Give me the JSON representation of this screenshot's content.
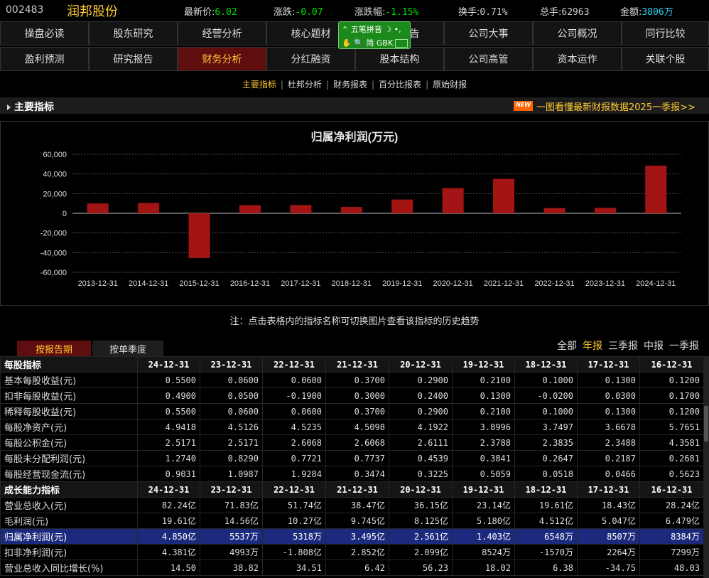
{
  "stock": {
    "code": "002483",
    "name": "润邦股份"
  },
  "quote": [
    {
      "label": "最新价:",
      "value": "6.02",
      "color": "green"
    },
    {
      "label": "涨跌:",
      "value": "-0.07",
      "color": "green"
    },
    {
      "label": "涨跌幅:",
      "value": "-1.15%",
      "color": "green"
    },
    {
      "label": "换手:",
      "value": "0.71%",
      "color": "plain"
    },
    {
      "label": "总手:",
      "value": "62963",
      "color": "plain"
    },
    {
      "label": "金额:",
      "value": "3806万",
      "color": "cyan"
    }
  ],
  "nav_row1": [
    "操盘必读",
    "股东研究",
    "经营分析",
    "核心题材",
    "新闻公告",
    "公司大事",
    "公司概况",
    "同行比较"
  ],
  "nav_row2": [
    "盈利预测",
    "研究报告",
    "财务分析",
    "分红融资",
    "股本结构",
    "公司高管",
    "资本运作",
    "关联个股"
  ],
  "active_nav": "财务分析",
  "ime": {
    "name": "五笔拼音",
    "mode": "简",
    "encoding": "GBK"
  },
  "subnav": [
    "主要指标",
    "杜邦分析",
    "财务报表",
    "百分比报表",
    "原始财报"
  ],
  "active_subnav": "主要指标",
  "section_title": "主要指标",
  "promo": {
    "badge": "NEW",
    "text": "一图看懂最新财报数据2025一季报>>"
  },
  "chart_data": {
    "type": "bar",
    "title": "归属净利润(万元)",
    "categories": [
      "2013-12-31",
      "2014-12-31",
      "2015-12-31",
      "2016-12-31",
      "2017-12-31",
      "2018-12-31",
      "2019-12-31",
      "2020-12-31",
      "2021-12-31",
      "2022-12-31",
      "2023-12-31",
      "2024-12-31"
    ],
    "values": [
      10000,
      10500,
      -45500,
      8200,
      8400,
      6500,
      14000,
      25600,
      35000,
      5318,
      5537,
      48500
    ],
    "ylim": [
      -60000,
      60000
    ],
    "yticks": [
      "60,000",
      "40,000",
      "20,000",
      "0",
      "-20,000",
      "-40,000",
      "-60,000"
    ],
    "ytick_values": [
      60000,
      40000,
      20000,
      0,
      -20000,
      -40000,
      -60000
    ],
    "bar_color": "#a31515",
    "grid": true
  },
  "note": "注：点击表格内的指标名称可切换图片查看该指标的历史趋势",
  "tabs": [
    "按报告期",
    "按单季度"
  ],
  "periods": [
    "全部",
    "年报",
    "三季报",
    "中报",
    "一季报"
  ],
  "active_period": "年报",
  "table": {
    "dates": [
      "24-12-31",
      "23-12-31",
      "22-12-31",
      "21-12-31",
      "20-12-31",
      "19-12-31",
      "18-12-31",
      "17-12-31",
      "16-12-31"
    ],
    "sections": [
      {
        "title": "每股指标",
        "rows": [
          {
            "name": "基本每股收益(元)",
            "values": [
              "0.5500",
              "0.0600",
              "0.0600",
              "0.3700",
              "0.2900",
              "0.2100",
              "0.1000",
              "0.1300",
              "0.1200"
            ]
          },
          {
            "name": "扣非每股收益(元)",
            "values": [
              "0.4900",
              "0.0500",
              "-0.1900",
              "0.3000",
              "0.2400",
              "0.1300",
              "-0.0200",
              "0.0300",
              "0.1700"
            ]
          },
          {
            "name": "稀释每股收益(元)",
            "values": [
              "0.5500",
              "0.0600",
              "0.0600",
              "0.3700",
              "0.2900",
              "0.2100",
              "0.1000",
              "0.1300",
              "0.1200"
            ]
          },
          {
            "name": "每股净资产(元)",
            "values": [
              "4.9418",
              "4.5126",
              "4.5235",
              "4.5098",
              "4.1922",
              "3.8996",
              "3.7497",
              "3.6678",
              "5.7651"
            ]
          },
          {
            "name": "每股公积金(元)",
            "values": [
              "2.5171",
              "2.5171",
              "2.6068",
              "2.6068",
              "2.6111",
              "2.3788",
              "2.3835",
              "2.3488",
              "4.3581"
            ]
          },
          {
            "name": "每股未分配利润(元)",
            "values": [
              "1.2740",
              "0.8290",
              "0.7721",
              "0.7737",
              "0.4539",
              "0.3841",
              "0.2647",
              "0.2187",
              "0.2681"
            ]
          },
          {
            "name": "每股经营现金流(元)",
            "values": [
              "0.9031",
              "1.0987",
              "1.9284",
              "0.3474",
              "0.3225",
              "0.5059",
              "0.0518",
              "0.0466",
              "0.5623"
            ]
          }
        ]
      },
      {
        "title": "成长能力指标",
        "rows": [
          {
            "name": "营业总收入(元)",
            "values": [
              "82.24亿",
              "71.83亿",
              "51.74亿",
              "38.47亿",
              "36.15亿",
              "23.14亿",
              "19.61亿",
              "18.43亿",
              "28.24亿"
            ]
          },
          {
            "name": "毛利润(元)",
            "values": [
              "19.61亿",
              "14.56亿",
              "10.27亿",
              "9.745亿",
              "8.125亿",
              "5.180亿",
              "4.512亿",
              "5.047亿",
              "6.479亿"
            ]
          },
          {
            "name": "归属净利润(元)",
            "values": [
              "4.850亿",
              "5537万",
              "5318万",
              "3.495亿",
              "2.561亿",
              "1.403亿",
              "6548万",
              "8507万",
              "8384万"
            ],
            "selected": true
          },
          {
            "name": "扣非净利润(元)",
            "values": [
              "4.381亿",
              "4993万",
              "-1.808亿",
              "2.852亿",
              "2.099亿",
              "8524万",
              "-1570万",
              "2264万",
              "7299万"
            ]
          },
          {
            "name": "营业总收入同比增长(%)",
            "values": [
              "14.50",
              "38.82",
              "34.51",
              "6.42",
              "56.23",
              "18.02",
              "6.38",
              "-34.75",
              "48.03"
            ]
          }
        ]
      }
    ]
  }
}
